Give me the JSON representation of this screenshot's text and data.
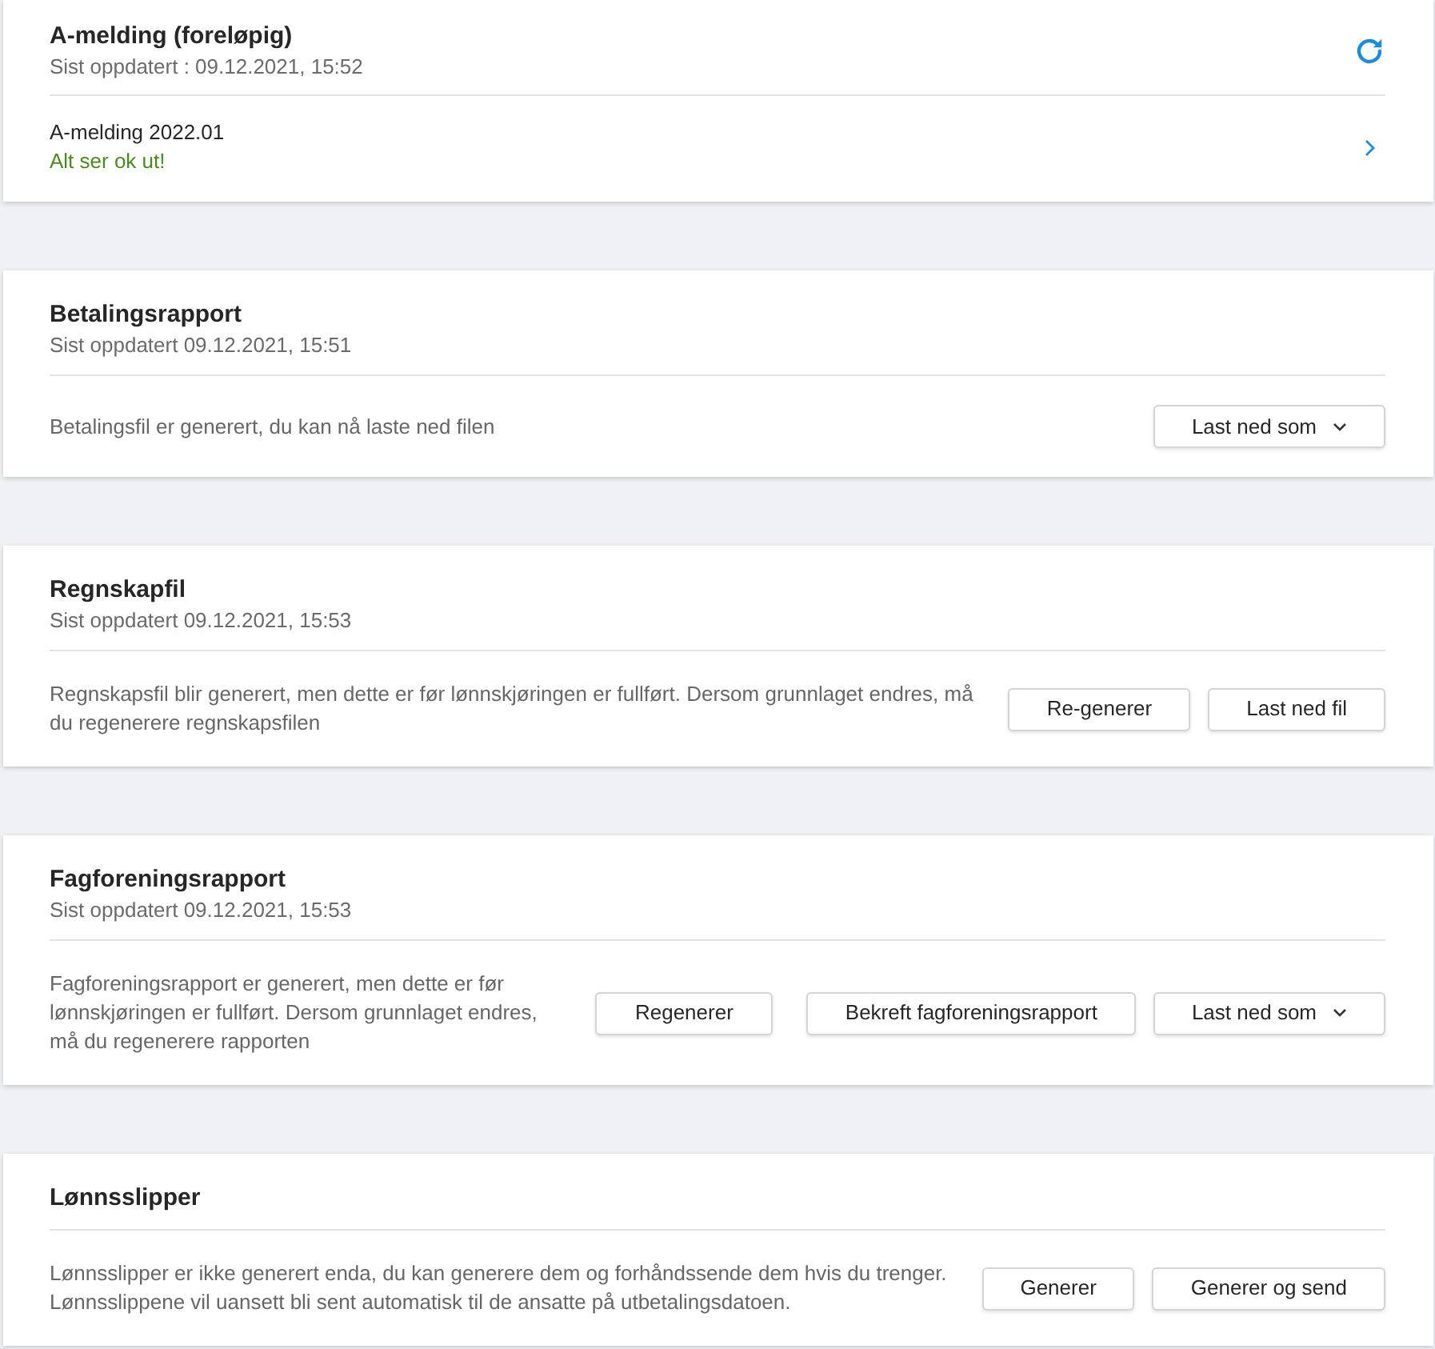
{
  "sections": [
    {
      "kind": "status",
      "title": "A-melding (foreløpig)",
      "updated": "Sist oppdatert : 09.12.2021, 15:52",
      "items": [
        {
          "name": "A-melding 2022.01",
          "status": "Alt ser ok ut!",
          "ok": true
        }
      ]
    },
    {
      "kind": "action",
      "title": "Betalingsrapport",
      "updated": "Sist oppdatert 09.12.2021, 15:51",
      "description": "Betalingsfil er generert, du kan nå laste ned filen",
      "buttons": [
        {
          "label": "Last ned som",
          "kind": "dropdown"
        }
      ]
    },
    {
      "kind": "action",
      "title": "Regnskapfil",
      "updated": "Sist oppdatert 09.12.2021, 15:53",
      "description": "Regnskapsfil blir generert, men dette er før lønnskjøringen er fullført. Dersom grunnlaget endres, må du regenerere regnskapsfilen",
      "buttons": [
        {
          "label": "Re-generer",
          "kind": "plain"
        },
        {
          "label": "Last ned fil",
          "kind": "plain"
        }
      ]
    },
    {
      "kind": "action",
      "title": "Fagforeningsrapport",
      "updated": "Sist oppdatert 09.12.2021, 15:53",
      "description": "Fagforeningsrapport er generert, men dette er før lønnskjøringen er fullført. Dersom grunnlaget endres, må du regenerere rapporten",
      "buttons": [
        {
          "label": "Regenerer",
          "kind": "plain"
        },
        {
          "label": "Bekreft fagforeningsrapport",
          "kind": "plain"
        },
        {
          "label": "Last ned som",
          "kind": "dropdown"
        }
      ]
    },
    {
      "kind": "action",
      "title": "Lønnsslipper",
      "description": "Lønnsslipper er ikke generert enda, du kan generere dem og forhåndssende dem hvis du trenger. Lønnsslippene vil uansett bli sent automatisk til de ansatte på utbetalingsdatoen.",
      "buttons": [
        {
          "label": "Generer",
          "kind": "plain"
        },
        {
          "label": "Generer og send",
          "kind": "plain"
        }
      ]
    }
  ]
}
